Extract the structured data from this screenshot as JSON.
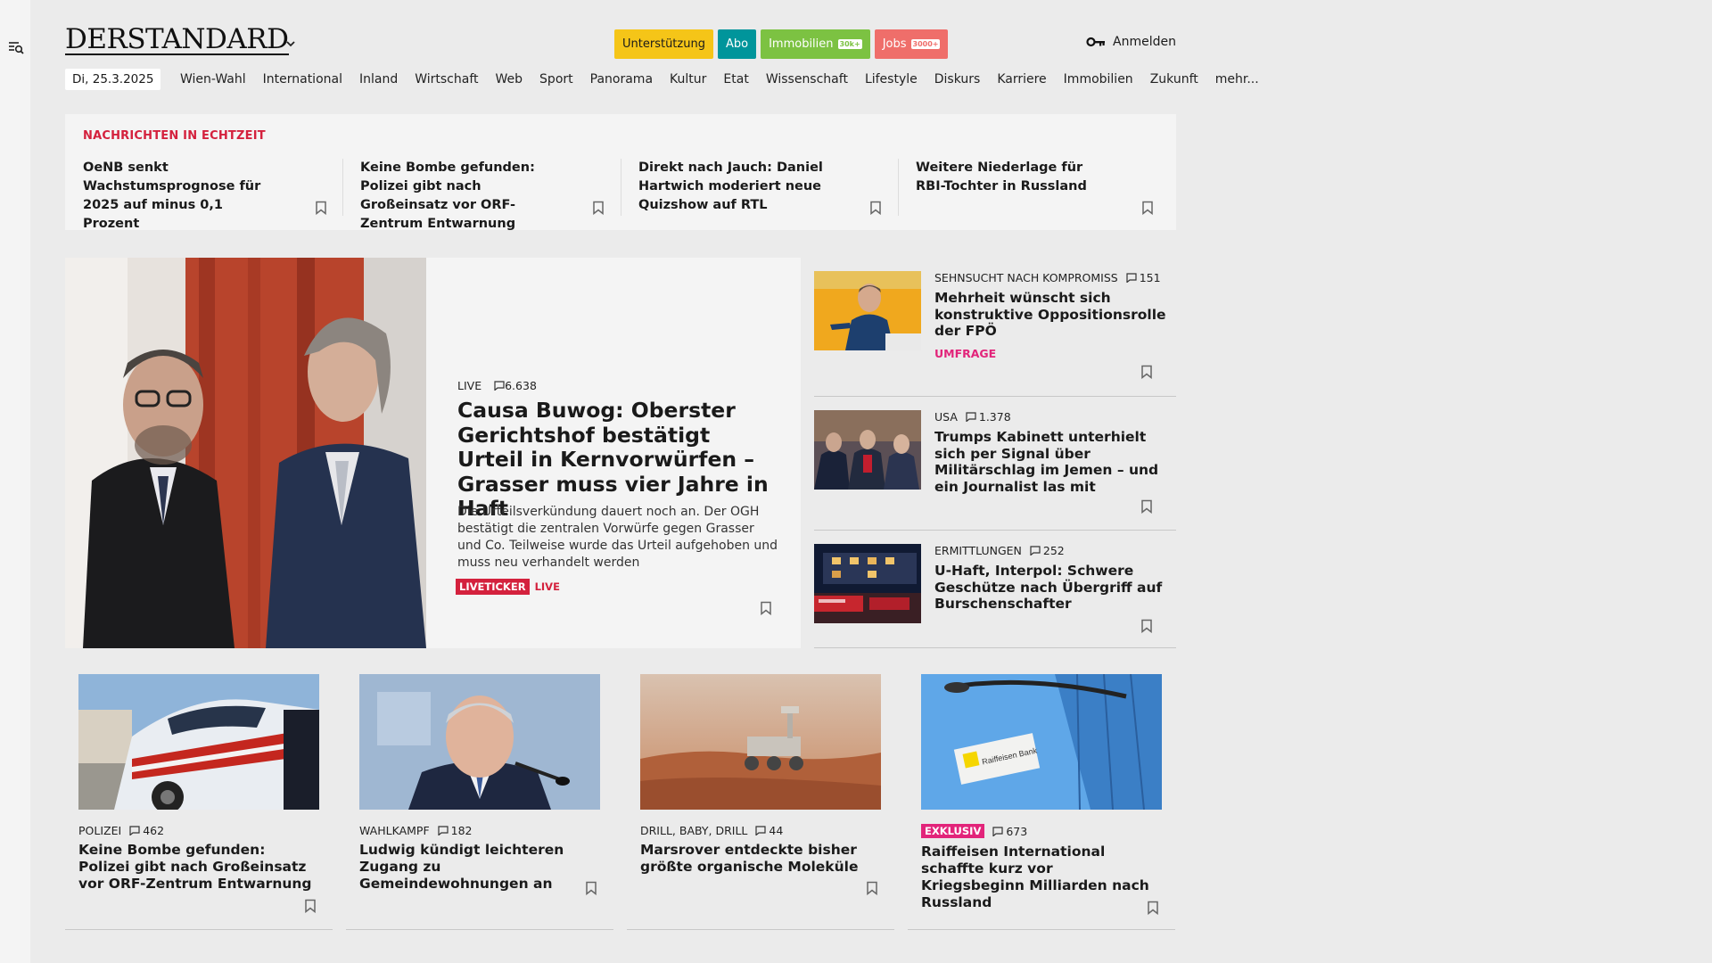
{
  "header": {
    "logo": "DERSTANDARD",
    "buttons": {
      "support": "Unterstützung",
      "abo": "Abo",
      "immobilien": "Immobilien",
      "immobilien_badge": "30k+",
      "jobs": "Jobs",
      "jobs_badge": "3000+"
    },
    "login": "Anmelden"
  },
  "nav": {
    "date": "Di, 25.3.2025",
    "items": [
      "Wien-Wahl",
      "International",
      "Inland",
      "Wirtschaft",
      "Web",
      "Sport",
      "Panorama",
      "Kultur",
      "Etat",
      "Wissenschaft",
      "Lifestyle",
      "Diskurs",
      "Karriere",
      "Immobilien",
      "Zukunft",
      "mehr..."
    ]
  },
  "ticker": {
    "title": "NACHRICHTEN IN ECHTZEIT",
    "items": [
      {
        "title": "OeNB senkt Wachstumsprognose für 2025 auf minus 0,1 Prozent"
      },
      {
        "title": "Keine Bombe gefunden: Polizei gibt nach Großeinsatz vor ORF-Zentrum Entwarnung"
      },
      {
        "title": "Direkt nach Jauch: Daniel Hartwich moderiert neue Quizshow auf RTL"
      },
      {
        "title": "Weitere Niederlage für RBI-Tochter in Russland"
      }
    ]
  },
  "lead": {
    "kicker": "LIVE",
    "comments": "6.638",
    "title": "Causa Buwog: Oberster Gerichtshof bestätigt Urteil in Kernvorwürfen – Grasser muss vier Jahre in Haft",
    "teaser": "Die Urteilsverkündung dauert noch an. Der OGH bestätigt die zentralen Vorwürfe gegen Grasser und Co. Teilweise wurde das Urteil aufgehoben und muss neu verhandelt werden",
    "tag_liveticker": "LIVETICKER",
    "tag_live": "LIVE"
  },
  "side": [
    {
      "kicker": "SEHNSUCHT NACH KOMPROMISS",
      "comments": "151",
      "title": "Mehrheit wünscht sich konstruktive Oppositionsrolle der FPÖ",
      "tag": "UMFRAGE"
    },
    {
      "kicker": "USA",
      "comments": "1.378",
      "title": "Trumps Kabinett unterhielt sich per Signal über Militärschlag im Jemen – und ein Journalist las mit"
    },
    {
      "kicker": "ERMITTLUNGEN",
      "comments": "252",
      "title": "U-Haft, Interpol: Schwere Geschütze nach Übergriff auf Burschenschafter"
    }
  ],
  "cards": [
    {
      "kicker": "POLIZEI",
      "comments": "462",
      "title": "Keine Bombe gefunden: Polizei gibt nach Großeinsatz vor ORF-Zentrum Entwarnung"
    },
    {
      "kicker": "WAHLKAMPF",
      "comments": "182",
      "title": "Ludwig kündigt leichteren Zugang zu Gemeindewohnungen an"
    },
    {
      "kicker": "DRILL, BABY, DRILL",
      "comments": "44",
      "title": "Marsrover entdeckte bisher größte organische Moleküle"
    },
    {
      "kicker": "EXKLUSIV",
      "comments": "673",
      "title": "Raiffeisen International schaffte kurz vor Kriegsbeginn Milliarden nach Russland"
    }
  ],
  "colors": {
    "accent_red": "#d4213d",
    "tag_pink": "#e2247a",
    "support_yellow": "#f5c518",
    "abo_teal": "#00959b",
    "immo_green": "#7cc242",
    "jobs_red": "#ef6e6a"
  }
}
